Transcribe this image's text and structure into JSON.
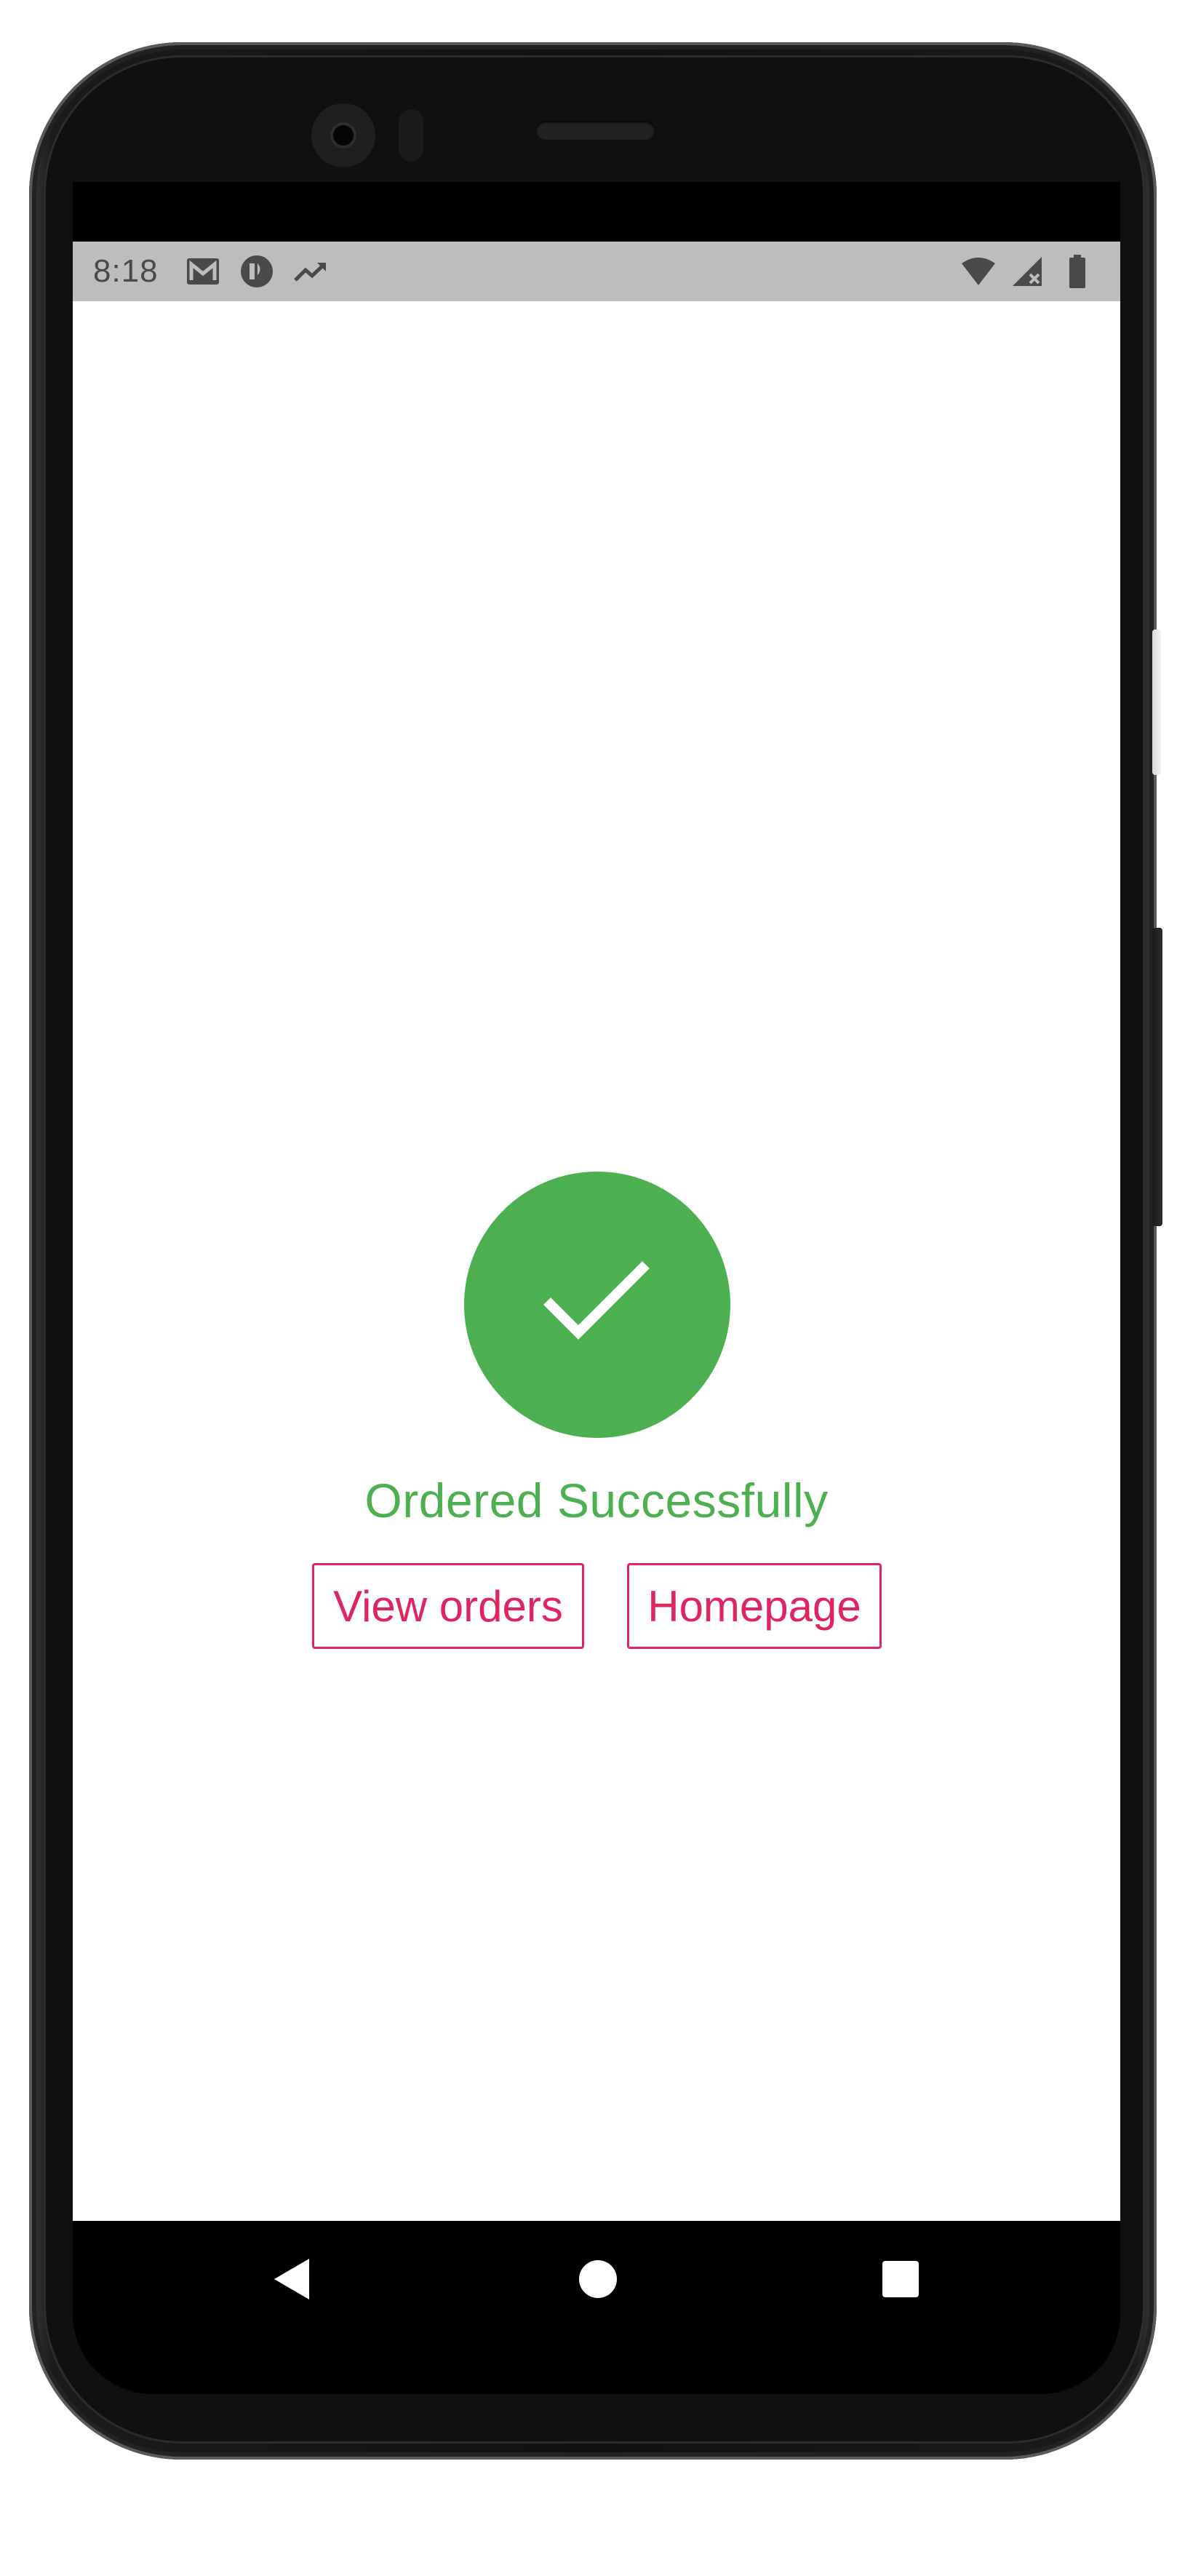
{
  "status_bar": {
    "time": "8:18",
    "left_icons": [
      "gmail-icon",
      "cloud-app-icon",
      "trending-icon"
    ],
    "right_icons": [
      "wifi-icon",
      "no-signal-icon",
      "battery-icon"
    ],
    "background": "#bdbdbd"
  },
  "order_result": {
    "icon": "check-icon",
    "message": "Ordered Successfully",
    "success_color": "#4caf50"
  },
  "actions": {
    "view_orders_label": "View orders",
    "homepage_label": "Homepage",
    "accent_color": "#e0245e"
  },
  "nav_bar": {
    "buttons": [
      "back-icon",
      "home-icon",
      "recents-icon"
    ]
  }
}
